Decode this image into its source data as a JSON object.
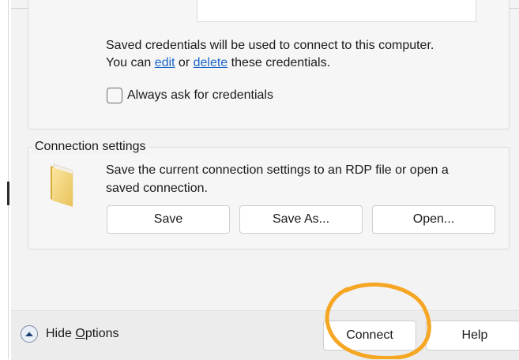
{
  "credentials": {
    "line1": "Saved credentials will be used to connect to this computer.",
    "line2_prefix": "You can ",
    "edit_link": "edit",
    "or_text": " or ",
    "delete_link": "delete",
    "line2_suffix": " these credentials.",
    "always_ask_label": "Always ask for credentials",
    "always_ask_checked": false
  },
  "connection_settings": {
    "legend": "Connection settings",
    "description_line1": "Save the current connection settings to an RDP file or open a",
    "description_line2": "saved connection.",
    "icon": "folder-icon",
    "save_label": "Save",
    "save_as_label": "Save As...",
    "open_label": "Open..."
  },
  "footer": {
    "hide_options_prefix": "Hide ",
    "hide_options_mnemonic": "O",
    "hide_options_suffix": "ptions",
    "hide_options_icon": "chevron-up-icon",
    "connect_label": "Connect",
    "help_label": "Help"
  },
  "colors": {
    "link": "#1a64c8",
    "annotation_circle": "#f5a623",
    "dialog_background": "#f3f3f3"
  }
}
